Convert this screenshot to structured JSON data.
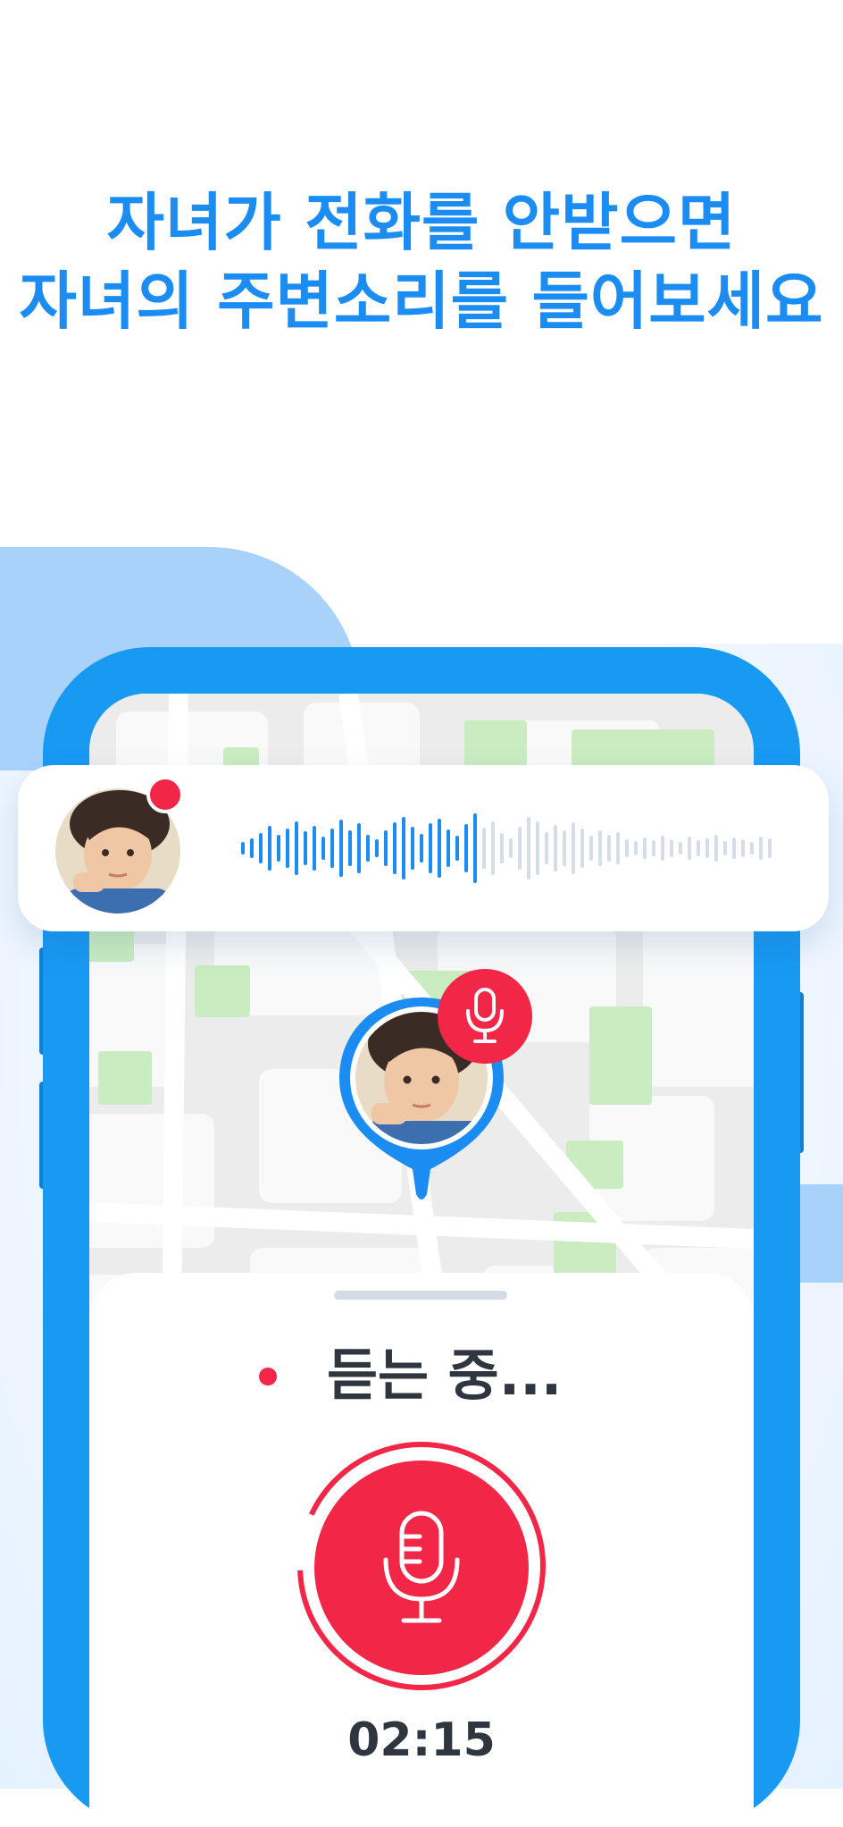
{
  "headline": {
    "line1": "자녀가 전화를 안받으면",
    "line2": "자녀의 주변소리를 들어보세요"
  },
  "listening": {
    "status": "듣는 중...",
    "timer": "02:15"
  },
  "icons": {
    "record_indicator": "red-dot-icon",
    "pin_mic": "microphone-icon",
    "record_button": "microphone-icon",
    "child_photo": "child-avatar"
  },
  "colors": {
    "brand_blue": "#1899f2",
    "headline_blue": "#1b8cf2",
    "record_red": "#f22646",
    "map_green": "#c9edc0",
    "text_dark": "#2f3640"
  }
}
